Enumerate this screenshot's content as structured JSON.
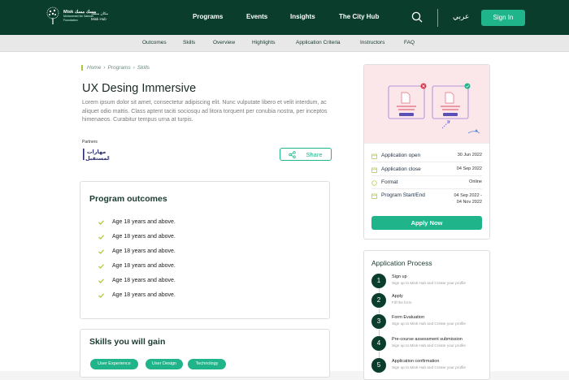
{
  "header": {
    "logo": {
      "ar": "مسك مسك",
      "line1": "Misk",
      "line2": "Mohammed bin Salman",
      "line3": "Foundation"
    },
    "hub_logo": {
      "ar": "مكان مسك",
      "en": "Misk Hub"
    },
    "nav": [
      "Programs",
      "Events",
      "Insights",
      "The City Hub"
    ],
    "lang": "عربي",
    "signin": "Sign In"
  },
  "subnav": [
    "Outcomes",
    "Skills",
    "Overview",
    "Highlights",
    "Application Criteria",
    "Instructors",
    "FAQ"
  ],
  "breadcrumb": [
    "Home",
    "Programs",
    "Skills"
  ],
  "program": {
    "title": "UX Desing Immersive",
    "description": "Lorem ipsum dolor sit amet, consectetur adipiscing elit. Nunc vulputate libero et velit interdum, ac aliquet odio mattis. Class aptent taciti sociosqu ad litora torquent per conubia nostra, per inceptos himenaeos. Curabitur tempus urna at turpis.",
    "partners_label": "Partners",
    "partner_name": "مهارات المستقبل",
    "share": "Share"
  },
  "outcomes": {
    "heading": "Program outcomes",
    "items": [
      "Age 18 years and above.",
      "Age 18 years and above.",
      "Age 18 years and above.",
      "Age 18 years and above.",
      "Age 18 years and above.",
      "Age 18 years and above."
    ]
  },
  "skills": {
    "heading": "Skills you will gain",
    "chips": [
      "User Experience",
      "User Design",
      "Technology"
    ]
  },
  "details": {
    "rows": [
      {
        "label": "Application open",
        "value": "30  Jun 2022"
      },
      {
        "label": "Application close",
        "value": "04  Sep 2022"
      },
      {
        "label": "Format",
        "value": "Online"
      },
      {
        "label": "Program Start/End",
        "value": "04  Sep 2022 -",
        "value2": "04 Nov 2022"
      }
    ],
    "apply": "Apply Now"
  },
  "process": {
    "heading": "Application Process",
    "steps": [
      {
        "num": "1",
        "title": "Sign up",
        "desc": "Sign up to Misk Hub and Create your profile"
      },
      {
        "num": "2",
        "title": "Apply",
        "desc": "Fill the form"
      },
      {
        "num": "3",
        "title": "Form Evaluation",
        "desc": "Sign up to Misk Hub and Create your profile"
      },
      {
        "num": "4",
        "title": "Pre-course assessment submission",
        "desc": "Sign up to Misk Hub and Create your profile"
      },
      {
        "num": "5",
        "title": "Application confirmation",
        "desc": "Sign up to Misk Hub and Create your profile"
      }
    ]
  },
  "colors": {
    "primary_dark": "#0b3d2c",
    "accent": "#1fb489",
    "illustration_bg": "#fbe6ea"
  }
}
